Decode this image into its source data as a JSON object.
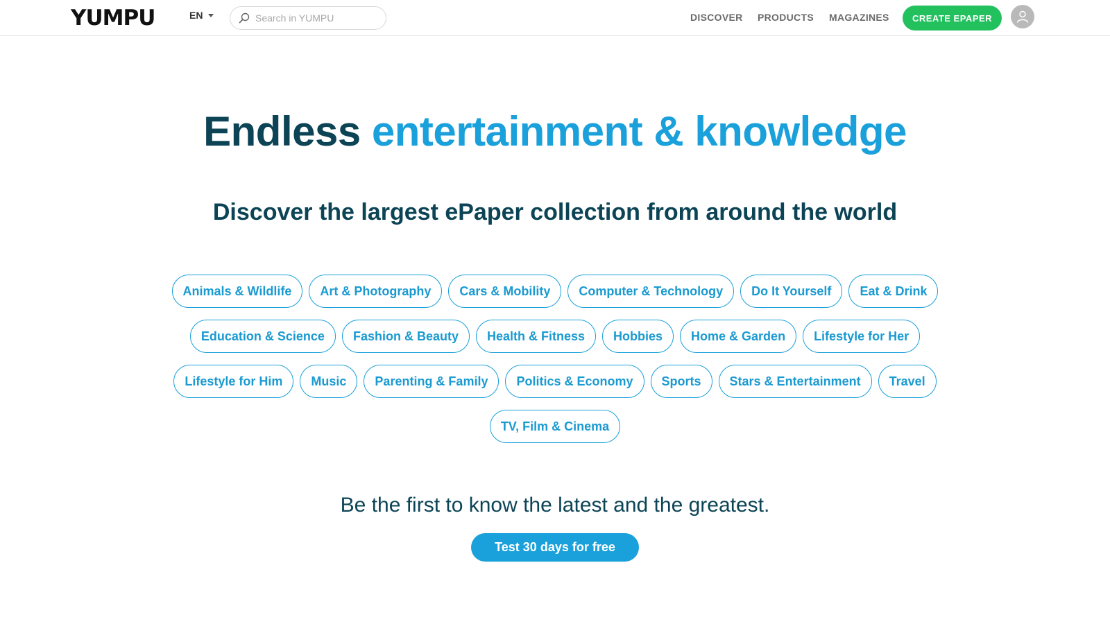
{
  "header": {
    "logo": "YUMPU",
    "language": "EN",
    "search": {
      "placeholder": "Search in YUMPU",
      "value": ""
    },
    "nav": [
      "DISCOVER",
      "PRODUCTS",
      "MAGAZINES"
    ],
    "cta_label": "CREATE EPAPER",
    "icons": {
      "search": "search-icon",
      "caret": "caret-down-icon",
      "user": "user-icon"
    }
  },
  "hero": {
    "title_dark": "Endless",
    "title_blue": "entertainment & knowledge",
    "subtitle": "Discover the largest ePaper collection from around the world"
  },
  "categories": [
    "Animals & Wildlife",
    "Art & Photography",
    "Cars & Mobility",
    "Computer & Technology",
    "Do It Yourself",
    "Eat & Drink",
    "Education & Science",
    "Fashion & Beauty",
    "Health & Fitness",
    "Hobbies",
    "Home & Garden",
    "Lifestyle for Her",
    "Lifestyle for Him",
    "Music",
    "Parenting & Family",
    "Politics & Economy",
    "Sports",
    "Stars & Entertainment",
    "Travel",
    "TV, Film & Cinema"
  ],
  "promo": {
    "tagline": "Be the first to know the latest and the greatest.",
    "button_label": "Test 30 days for free"
  },
  "colors": {
    "brand_dark": "#0c4456",
    "brand_blue": "#1aa0da",
    "cta_green": "#22c15e"
  }
}
